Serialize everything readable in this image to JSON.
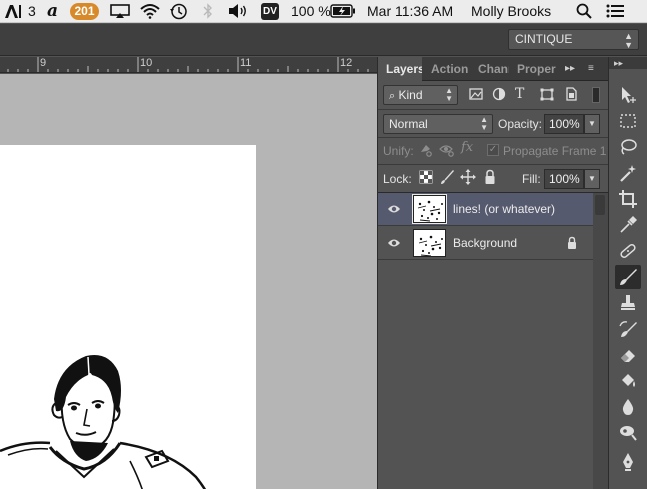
{
  "menubar": {
    "adobe_count": "3",
    "badge": "201",
    "dv_label": "DV",
    "battery_percent": "100 %",
    "clock": "Mar 11:36 AM",
    "user": "Molly Brooks",
    "icons": [
      "adobe-cc-icon",
      "a-icon",
      "airplay-icon",
      "wifi-icon",
      "time-machine-icon",
      "bluetooth-icon",
      "volume-icon",
      "dv-icon",
      "battery-icon",
      "spotlight-icon",
      "notification-center-icon"
    ]
  },
  "appbar": {
    "workspace": "CINTIQUE"
  },
  "ruler": {
    "labels": [
      "9",
      "10",
      "11",
      "12"
    ]
  },
  "panel": {
    "tabs": [
      {
        "label": "Layers",
        "active": true
      },
      {
        "label": "Action",
        "active": false
      },
      {
        "label": "Chann",
        "active": false
      },
      {
        "label": "Proper",
        "active": false
      }
    ],
    "collapse_glyph": "▸▸",
    "menu_glyph": "≡",
    "filter": {
      "kind_label": "Kind",
      "icons": [
        "pixel-filter-icon",
        "adjustment-filter-icon",
        "type-filter-icon",
        "shape-filter-icon",
        "smart-object-filter-icon"
      ]
    },
    "blend_mode": "Normal",
    "opacity_label": "Opacity:",
    "opacity_value": "100%",
    "unify_label": "Unify:",
    "propagate_label": "Propagate Frame 1",
    "lock_label": "Lock:",
    "fill_label": "Fill:",
    "fill_value": "100%",
    "layers": [
      {
        "name": "lines! (or whatever)",
        "selected": true,
        "visible": true,
        "locked": false
      },
      {
        "name": "Background",
        "selected": false,
        "visible": true,
        "locked": true
      }
    ]
  },
  "toolbar": {
    "head_glyph": "▸▸",
    "tools": [
      "move-tool",
      "marquee-tool",
      "lasso-tool",
      "magic-wand-tool",
      "crop-tool",
      "eyedropper-tool",
      "healing-brush-tool",
      "brush-tool",
      "clone-stamp-tool",
      "history-brush-tool",
      "eraser-tool",
      "paint-bucket-tool",
      "blur-tool",
      "dodge-tool",
      "pen-tool"
    ],
    "active_tool": "brush-tool"
  },
  "colors": {
    "panel_bg": "#535353",
    "dark_bg": "#3b3b3b",
    "canvas_bg": "#b5b5b5",
    "selected_layer": "#565a6e",
    "badge": "#d88a2a"
  }
}
